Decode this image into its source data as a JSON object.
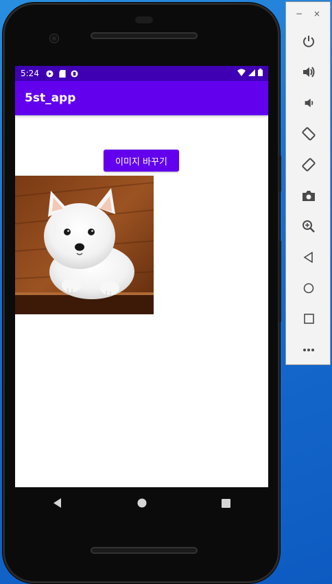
{
  "status_bar": {
    "time": "5:24"
  },
  "app_bar": {
    "title": "5st_app"
  },
  "main": {
    "change_image_button": "이미지 바꾸기",
    "photo_subject": "white puppy on wooden floor"
  },
  "nav_bar": {
    "icons": [
      "back-icon",
      "home-icon",
      "recents-icon"
    ]
  },
  "emulator_panel": {
    "window_controls": [
      "−",
      "×"
    ],
    "tools": [
      "power-icon",
      "volume-up-icon",
      "volume-down-icon",
      "rotate-left-icon",
      "rotate-right-icon",
      "camera-icon",
      "zoom-icon",
      "back-icon",
      "home-icon",
      "overview-icon",
      "more-icon"
    ]
  },
  "colors": {
    "status_bar": "#3f00b3",
    "app_bar": "#6200ee",
    "button": "#6200ee",
    "desktop": "#1a6fd0"
  }
}
